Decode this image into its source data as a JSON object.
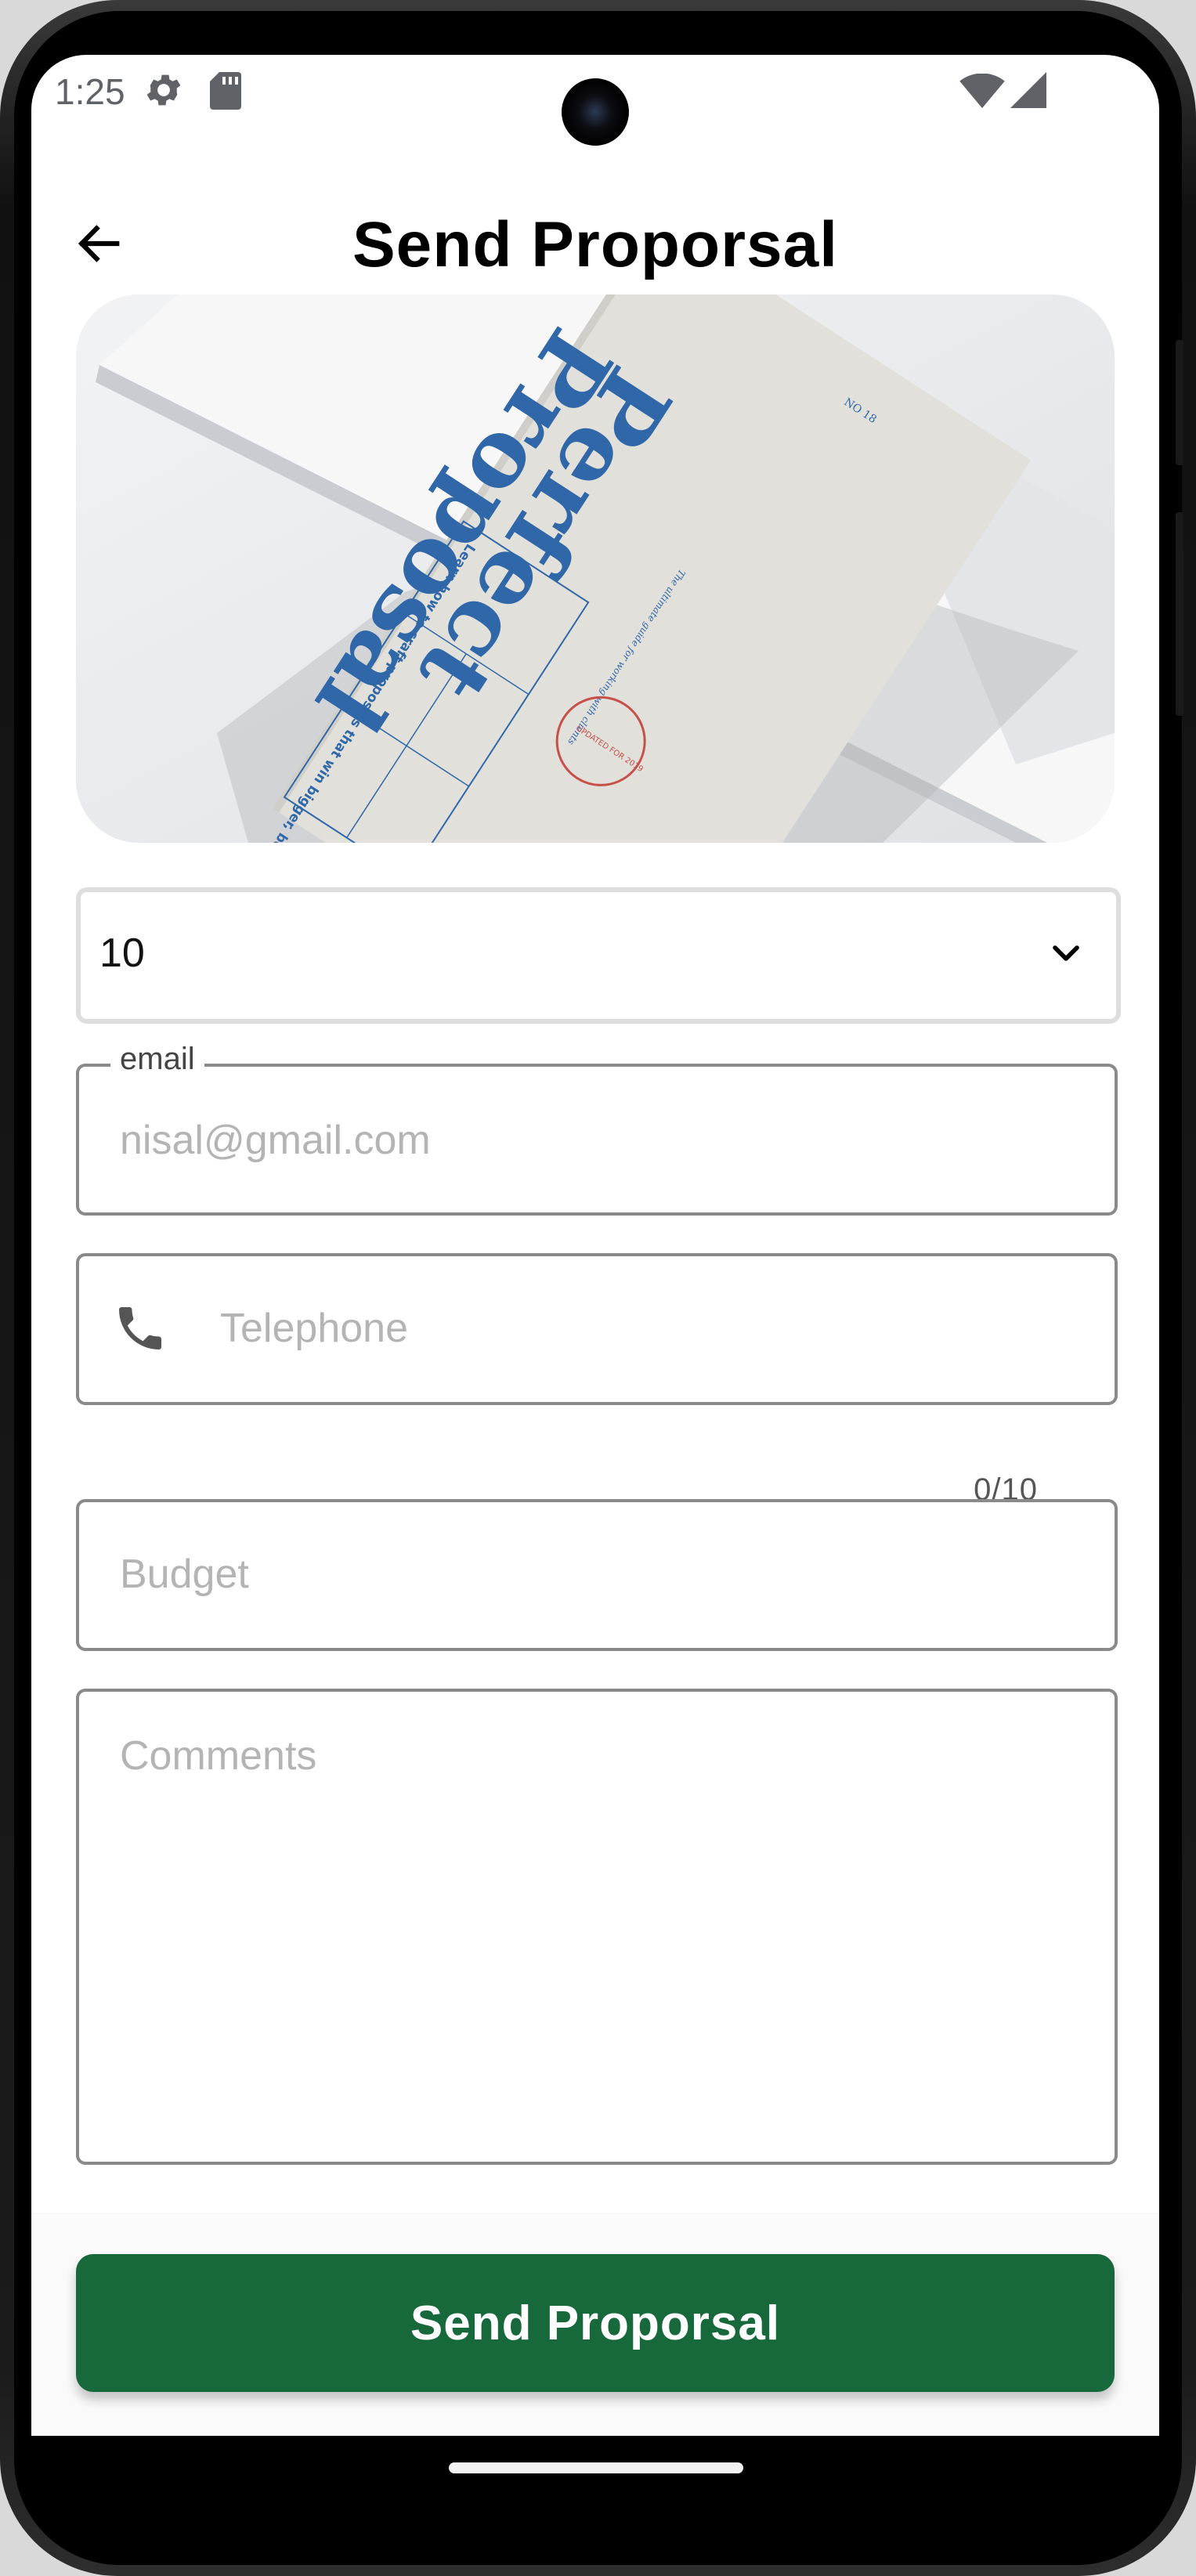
{
  "status_bar": {
    "time": "1:25",
    "icons": [
      "gear-icon",
      "sd-card-icon",
      "wifi-icon",
      "cell-signal-icon"
    ]
  },
  "app_bar": {
    "title": "Send Proporsal",
    "back_icon": "arrow-back-icon"
  },
  "hero_image": {
    "cover_title_line1": "Perfect",
    "cover_title_line2": "Proposal",
    "cover_issue": "NO 18",
    "cover_year": "2019",
    "cover_tagline": "The ultimate guide for working with clients",
    "cover_badge": "UPDATED FOR 2019",
    "cover_blurb": "Learn how to craft proposals that win bigger, better clients"
  },
  "form": {
    "quantity_dropdown": {
      "value": "10",
      "icon": "chevron-down-icon"
    },
    "email": {
      "label": "email",
      "placeholder": "nisal@gmail.com",
      "value": ""
    },
    "telephone": {
      "placeholder": "Telephone",
      "value": "",
      "counter": "0/10",
      "icon": "phone-icon"
    },
    "budget": {
      "placeholder": "Budget",
      "value": ""
    },
    "comments": {
      "placeholder": "Comments",
      "value": ""
    }
  },
  "actions": {
    "submit_label": "Send Proporsal"
  },
  "colors": {
    "primary_button": "#17683a",
    "field_border": "#8a8a8a",
    "cover_blue": "#2f67a8"
  }
}
